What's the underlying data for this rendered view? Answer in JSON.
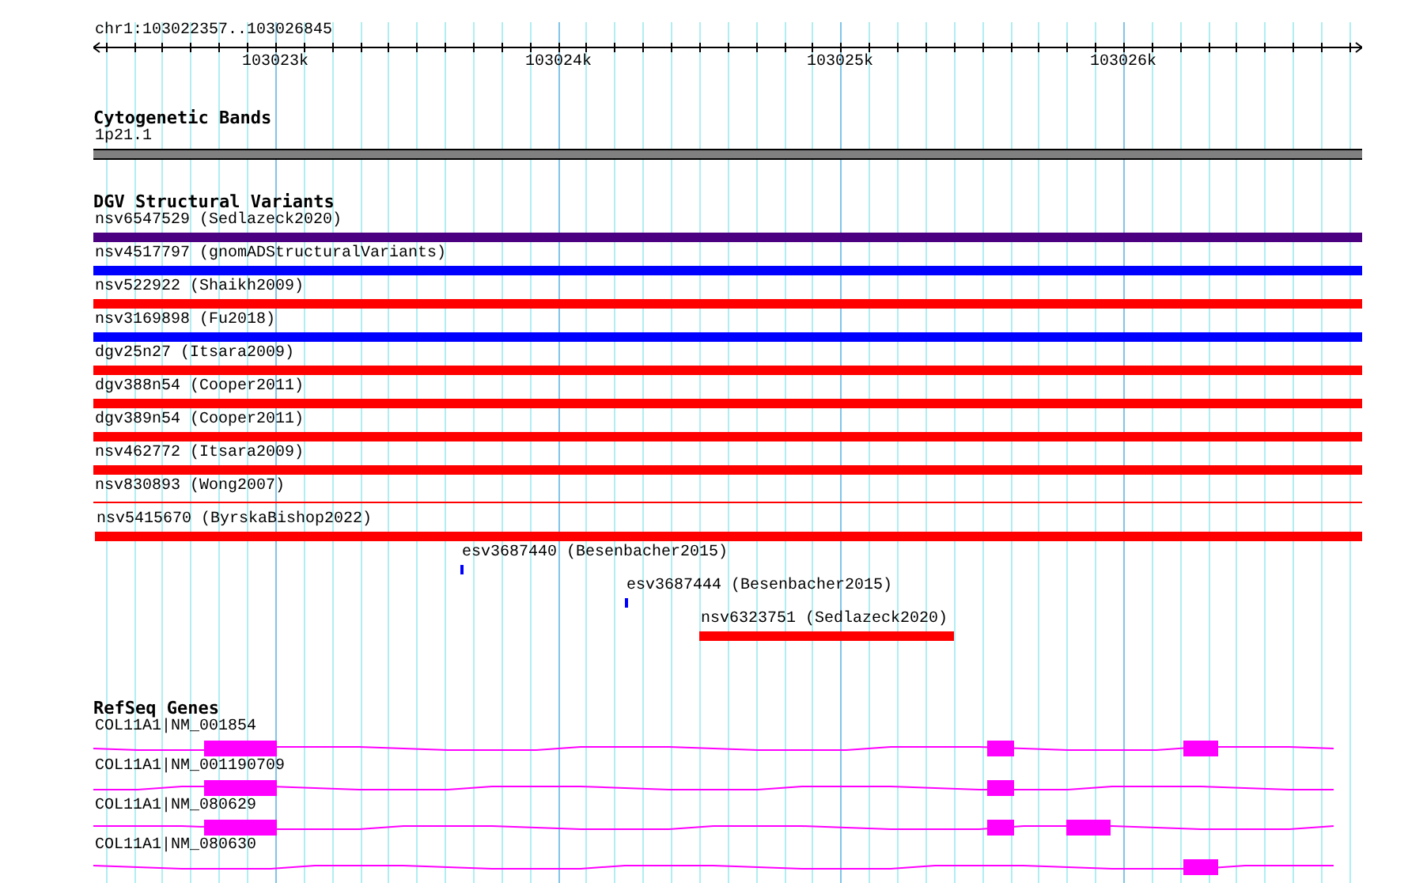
{
  "ruler": {
    "range": "chr1:103022357..103026845",
    "tick_labels": [
      "103023k",
      "103024k",
      "103025k",
      "103026k"
    ]
  },
  "cytogenetic_bands": {
    "title": "Cytogenetic Bands",
    "bands": [
      {
        "label": "1p21.1"
      }
    ]
  },
  "dgv_structural_variants": {
    "title": "DGV Structural Variants",
    "variants": [
      {
        "label": "nsv6547529 (Sedlazeck2020)",
        "color": "#4b0082",
        "kind": "bar"
      },
      {
        "label": "nsv4517797 (gnomADStructuralVariants)",
        "color": "#0000ff",
        "kind": "bar"
      },
      {
        "label": "nsv522922 (Shaikh2009)",
        "color": "#ff0000",
        "kind": "bar"
      },
      {
        "label": "nsv3169898 (Fu2018)",
        "color": "#0000ff",
        "kind": "bar"
      },
      {
        "label": "dgv25n27 (Itsara2009)",
        "color": "#ff0000",
        "kind": "bar"
      },
      {
        "label": "dgv388n54 (Cooper2011)",
        "color": "#ff0000",
        "kind": "bar"
      },
      {
        "label": "dgv389n54 (Cooper2011)",
        "color": "#ff0000",
        "kind": "bar"
      },
      {
        "label": "nsv462772 (Itsara2009)",
        "color": "#ff0000",
        "kind": "bar"
      },
      {
        "label": "nsv830893 (Wong2007)",
        "color": "#ff0000",
        "kind": "line"
      },
      {
        "label": "nsv5415670 (ByrskaBishop2022)",
        "color": "#ff0000",
        "kind": "bar"
      },
      {
        "label": "esv3687440 (Besenbacher2015)",
        "color": "#0000ff",
        "kind": "bar"
      },
      {
        "label": "esv3687444 (Besenbacher2015)",
        "color": "#0000ff",
        "kind": "bar"
      },
      {
        "label": "nsv6323751 (Sedlazeck2020)",
        "color": "#ff0000",
        "kind": "bar"
      }
    ]
  },
  "refseq_genes": {
    "title": "RefSeq Genes",
    "genes": [
      {
        "label": "COL11A1|NM_001854"
      },
      {
        "label": "COL11A1|NM_001190709"
      },
      {
        "label": "COL11A1|NM_080629"
      },
      {
        "label": "COL11A1|NM_080630"
      }
    ]
  }
}
